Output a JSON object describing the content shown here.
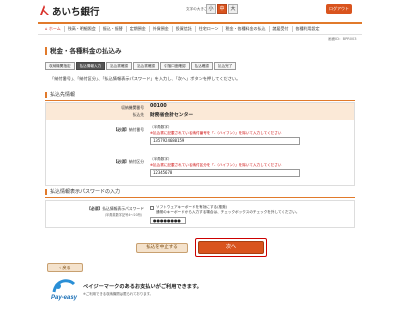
{
  "header": {
    "bank_name": "あいち銀行",
    "font_size_label": "文字の大きさ",
    "font_sizes": [
      "小",
      "中",
      "大"
    ],
    "logout_label": "ログアウト"
  },
  "nav": {
    "items": [
      "ホーム",
      "残高・明細照会",
      "振込・振替",
      "定期預金",
      "外貨預金",
      "投資信託",
      "住宅ローン",
      "税金・各種料金の払込",
      "諸届受付",
      "各種利用設定"
    ]
  },
  "screen_id": "画面ID：BPR003",
  "page_title": "税金・各種料金の払込み",
  "steps": [
    "収納機関指定",
    "払込情報入力",
    "払込書確認",
    "払込書確認",
    "引落口座確認",
    "払込確認",
    "払込完了"
  ],
  "instruction": "「納付番号」、「納付区分」、「払込情報表示パスワード」を入力し、「次へ」ボタンを押してください。",
  "payment_section": {
    "heading": "払込先情報",
    "agency_label": "収納機関番号",
    "agency_value": "00100",
    "payee_label": "払込先",
    "payee_value": "財務省会計センター",
    "number_label": "納付番号",
    "number_req": "【必須】",
    "number_note": "（半角数字）",
    "number_warn": "※払込書に記載されている納付番号を「-（ハイフン）」を除いて入力してください",
    "number_value": "1357924680159",
    "class_label": "納付区分",
    "class_req": "【必須】",
    "class_note": "（半角数字）",
    "class_warn": "※払込書に記載されている納付区分を「-（ハイフン）」を除いて入力してください",
    "class_value": "12345678"
  },
  "password_section": {
    "heading": "払込情報表示パスワードの入力",
    "label": "払込情報表示パスワード",
    "req": "【必須】",
    "sub_label": "（半角英数字記号4〜20桁）",
    "checkbox_label": "ソフトウェアキーボードを有効にする(推奨)",
    "checkbox_note": "通常のキーボードから入力する場合は、チェックボックスのチェックを外してください。",
    "value": "●●●●●●●●"
  },
  "buttons": {
    "stop": "払込を中止する",
    "next": "次へ",
    "back": "戻る"
  },
  "payeasy": {
    "logo_text": "Pay-easy",
    "headline": "ペイジーマークのあるお支払いがご利用できます。",
    "sub": "※ご利用できる収納機関は限られております。"
  }
}
